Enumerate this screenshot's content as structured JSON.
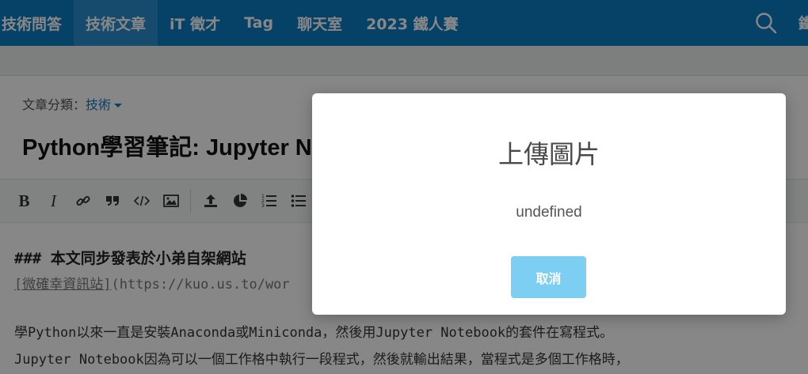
{
  "nav": {
    "items": [
      "技術問答",
      "技術文章",
      "iT 徵才",
      "Tag",
      "聊天室",
      "2023 鐵人賽"
    ],
    "active_index": 1,
    "cut_off_text": "鐵"
  },
  "article": {
    "category_label": "文章分類：",
    "category_value": "技術",
    "title": "Python學習筆記: Jupyter Ne"
  },
  "editor": {
    "heading": "###  本文同步發表於小弟自架網站",
    "link_text": "[微確幸資訊站]",
    "link_url": "(https://kuo.us.to/wor",
    "paragraph1": "學Python以來一直是安裝Anaconda或Miniconda，然後用Jupyter Notebook的套件在寫程式。",
    "paragraph2": "Jupyter Notebook因為可以一個工作格中執行一段程式，然後就輸出結果，當程式是多個工作格時，"
  },
  "modal": {
    "title": "上傳圖片",
    "message": "undefined",
    "cancel_label": "取消"
  },
  "colors": {
    "nav_bg": "#0c7bc4",
    "nav_active": "#2b8fd0",
    "cancel_button": "#7ccef3"
  }
}
